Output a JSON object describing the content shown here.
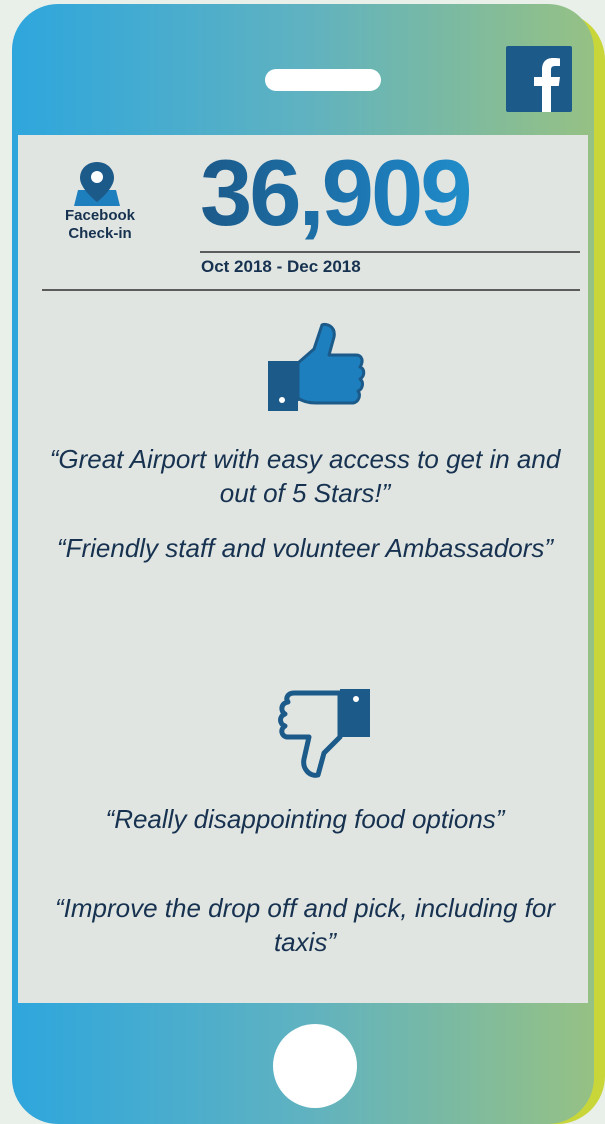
{
  "header": {
    "social_icon": "facebook-icon",
    "brand_color": "#1c5a8a"
  },
  "checkins": {
    "icon": "map-pin-icon",
    "label_line1": "Facebook",
    "label_line2": "Check-in",
    "count": "36,909",
    "period": "Oct 2018 - Dec 2018"
  },
  "positive": {
    "icon": "thumbs-up-icon",
    "quotes": [
      "“Great Airport with easy access to get in and out of 5 Stars!”",
      "“Friendly staff and volunteer Ambassadors”"
    ]
  },
  "negative": {
    "icon": "thumbs-down-icon",
    "quotes": [
      "“Really disappointing food options”",
      "“Improve the drop off and pick, including for taxis”"
    ]
  },
  "colors": {
    "navy": "#173250",
    "blue": "#1c5a8a",
    "cyan": "#27a8e0",
    "lime": "#c9d63a"
  }
}
